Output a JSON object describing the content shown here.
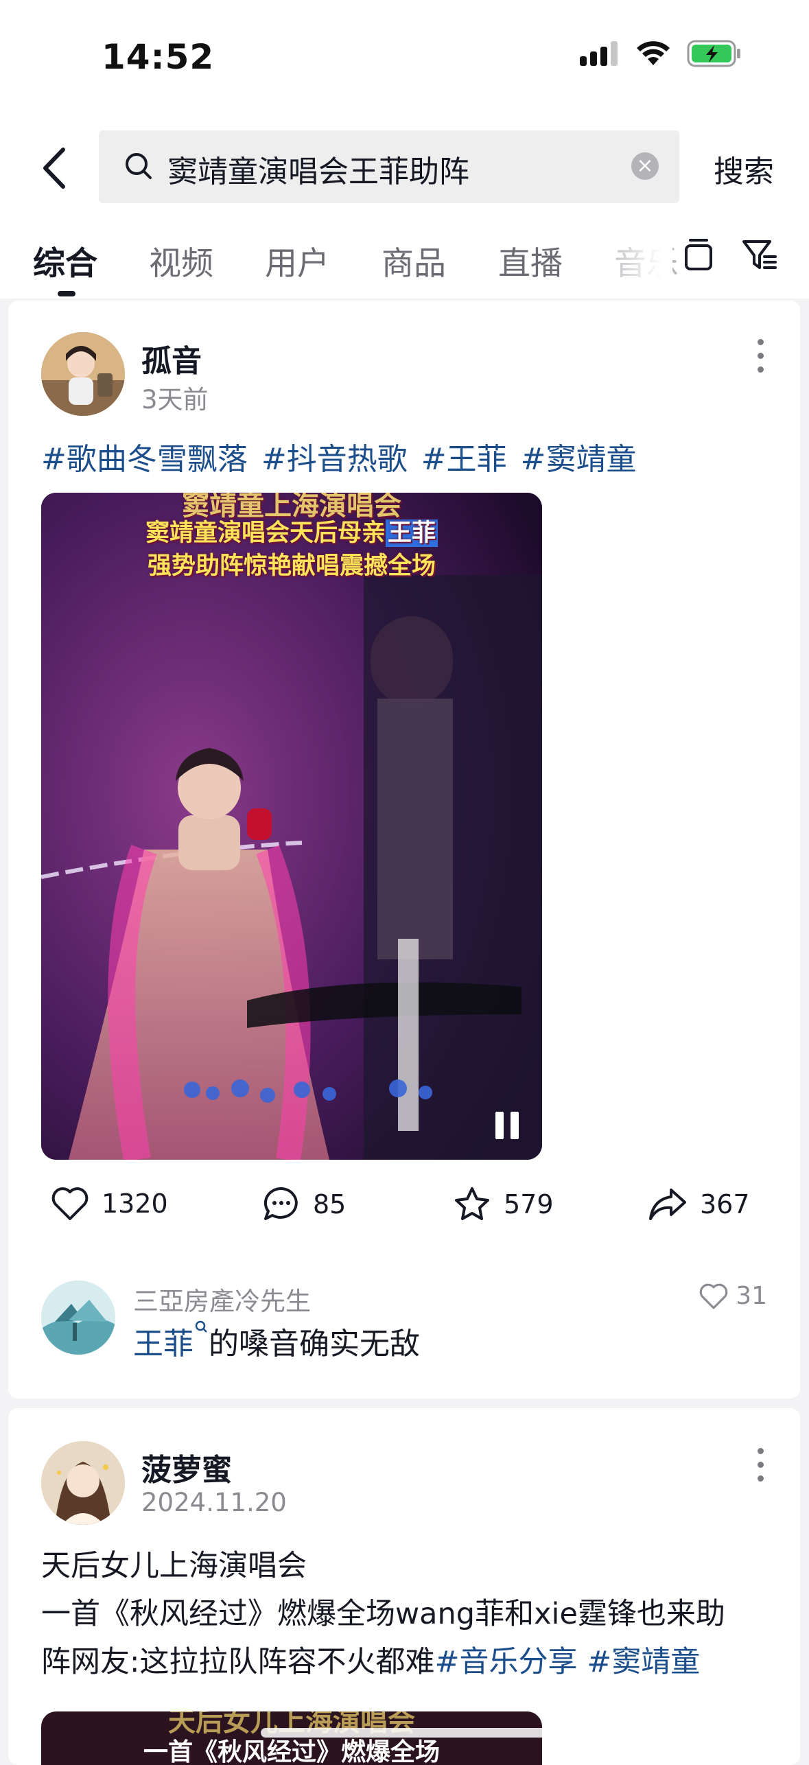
{
  "status_bar": {
    "time": "14:52"
  },
  "search": {
    "query": "窦靖童演唱会王菲助阵",
    "clear_icon": "×",
    "button_label": "搜索"
  },
  "tabs": [
    "综合",
    "视频",
    "用户",
    "商品",
    "直播",
    "音乐"
  ],
  "post1": {
    "author": "孤音",
    "time": "3天前",
    "hashtags": [
      "#歌曲冬雪飘落",
      "#抖音热歌",
      "#王菲",
      "#窦靖童"
    ],
    "video_caption_top": "窦靖童上海演唱会",
    "video_caption_line1": "窦靖童演唱会天后母亲",
    "video_caption_highlight": "王菲",
    "video_caption_line2": "强势助阵惊艳献唱震撼全场",
    "likes": "1320",
    "comments": "85",
    "favorites": "579",
    "shares": "367",
    "top_comment": {
      "user": "三亞房產冷先生",
      "text_link": "王菲",
      "text_rest": "的嗓音确实无敌",
      "likes": "31"
    }
  },
  "post2": {
    "author": "菠萝蜜",
    "time": "2024.11.20",
    "line1": "天后女儿上海演唱会",
    "line2": "一首《秋风经过》燃爆全场wang菲和xie霆锋也来助",
    "line3": "阵网友:这拉拉队阵容不火都难",
    "tags": [
      "#音乐分享",
      "#窦靖童"
    ],
    "thumb_caption_top": "天后女儿上海演唱会",
    "thumb_caption": "一首《秋风经过》燃爆全场"
  }
}
